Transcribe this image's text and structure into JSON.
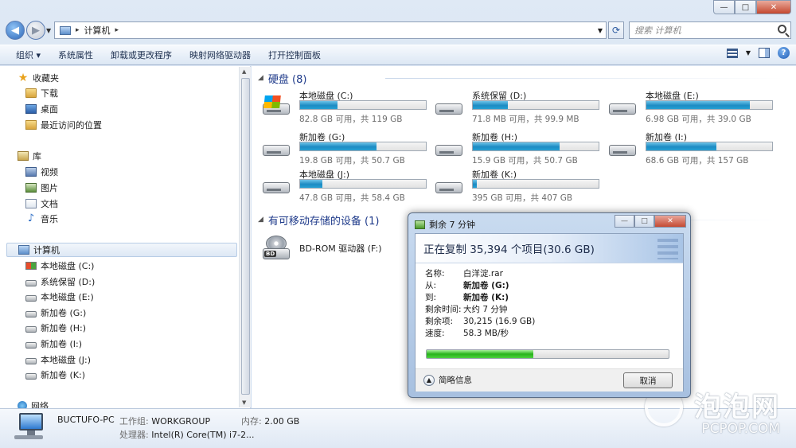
{
  "window": {
    "caption_buttons": {
      "minimize": "—",
      "maximize": "□",
      "close": "✕"
    }
  },
  "address": {
    "path": [
      "计算机"
    ],
    "search_placeholder": "搜索 计算机"
  },
  "toolbar": {
    "items": [
      "组织 ▾",
      "系统属性",
      "卸载或更改程序",
      "映射网络驱动器",
      "打开控制面板"
    ]
  },
  "nav": {
    "favorites": "收藏夹",
    "fav_items": [
      "下载",
      "桌面",
      "最近访问的位置"
    ],
    "libraries": "库",
    "lib_items": [
      "视频",
      "图片",
      "文档",
      "音乐"
    ],
    "computer": "计算机",
    "drives": [
      "本地磁盘 (C:)",
      "系统保留 (D:)",
      "本地磁盘 (E:)",
      "新加卷 (G:)",
      "新加卷 (H:)",
      "新加卷 (I:)",
      "本地磁盘 (J:)",
      "新加卷 (K:)"
    ],
    "network": "网络"
  },
  "content": {
    "hdd_header": "硬盘 (8)",
    "removable_header": "有可移动存储的设备 (1)",
    "drives": [
      {
        "name": "本地磁盘 (C:)",
        "size": "82.8 GB 可用，共 119 GB",
        "used": 0.3,
        "icon": "windows-drive-icon"
      },
      {
        "name": "系统保留 (D:)",
        "size": "71.8 MB 可用，共 99.9 MB",
        "used": 0.28,
        "icon": "drive-icon"
      },
      {
        "name": "本地磁盘 (E:)",
        "size": "6.98 GB 可用，共 39.0 GB",
        "used": 0.82,
        "icon": "drive-icon"
      },
      {
        "name": "新加卷 (G:)",
        "size": "19.8 GB 可用，共 50.7 GB",
        "used": 0.61,
        "icon": "drive-icon"
      },
      {
        "name": "新加卷 (H:)",
        "size": "15.9 GB 可用，共 50.7 GB",
        "used": 0.69,
        "icon": "drive-icon"
      },
      {
        "name": "新加卷 (I:)",
        "size": "68.6 GB 可用，共 157 GB",
        "used": 0.56,
        "icon": "drive-icon"
      },
      {
        "name": "本地磁盘 (J:)",
        "size": "47.8 GB 可用，共 58.4 GB",
        "used": 0.18,
        "icon": "drive-icon"
      },
      {
        "name": "新加卷 (K:)",
        "size": "395 GB 可用，共 407 GB",
        "used": 0.03,
        "icon": "drive-icon"
      }
    ],
    "removable": [
      {
        "name": "BD-ROM 驱动器 (F:)",
        "icon": "bd-rom-icon"
      }
    ]
  },
  "details": {
    "pc_name": "BUCTUFO-PC",
    "workgroup_label": "工作组:",
    "workgroup": "WORKGROUP",
    "memory_label": "内存:",
    "memory": "2.00 GB",
    "cpu_label": "处理器:",
    "cpu": "Intel(R) Core(TM) i7-2..."
  },
  "dialog": {
    "title": "剩余 7 分钟",
    "heading": "正在复制 35,394 个项目(30.6 GB)",
    "rows": [
      {
        "k": "名称:",
        "v": "白洋淀.rar",
        "bold": false
      },
      {
        "k": "从:",
        "v": "新加卷 (G:)",
        "bold": true
      },
      {
        "k": "到:",
        "v": "新加卷 (K:)",
        "bold": true
      },
      {
        "k": "剩余时间:",
        "v": "大约 7 分钟",
        "bold": false
      },
      {
        "k": "剩余项:",
        "v": "30,215 (16.9 GB)",
        "bold": false
      },
      {
        "k": "速度:",
        "v": "58.3 MB/秒",
        "bold": false
      }
    ],
    "progress": 0.44,
    "more_info": "简略信息",
    "cancel": "取消"
  },
  "watermark": {
    "cn": "泡泡网",
    "en": "PCPOP.COM"
  }
}
